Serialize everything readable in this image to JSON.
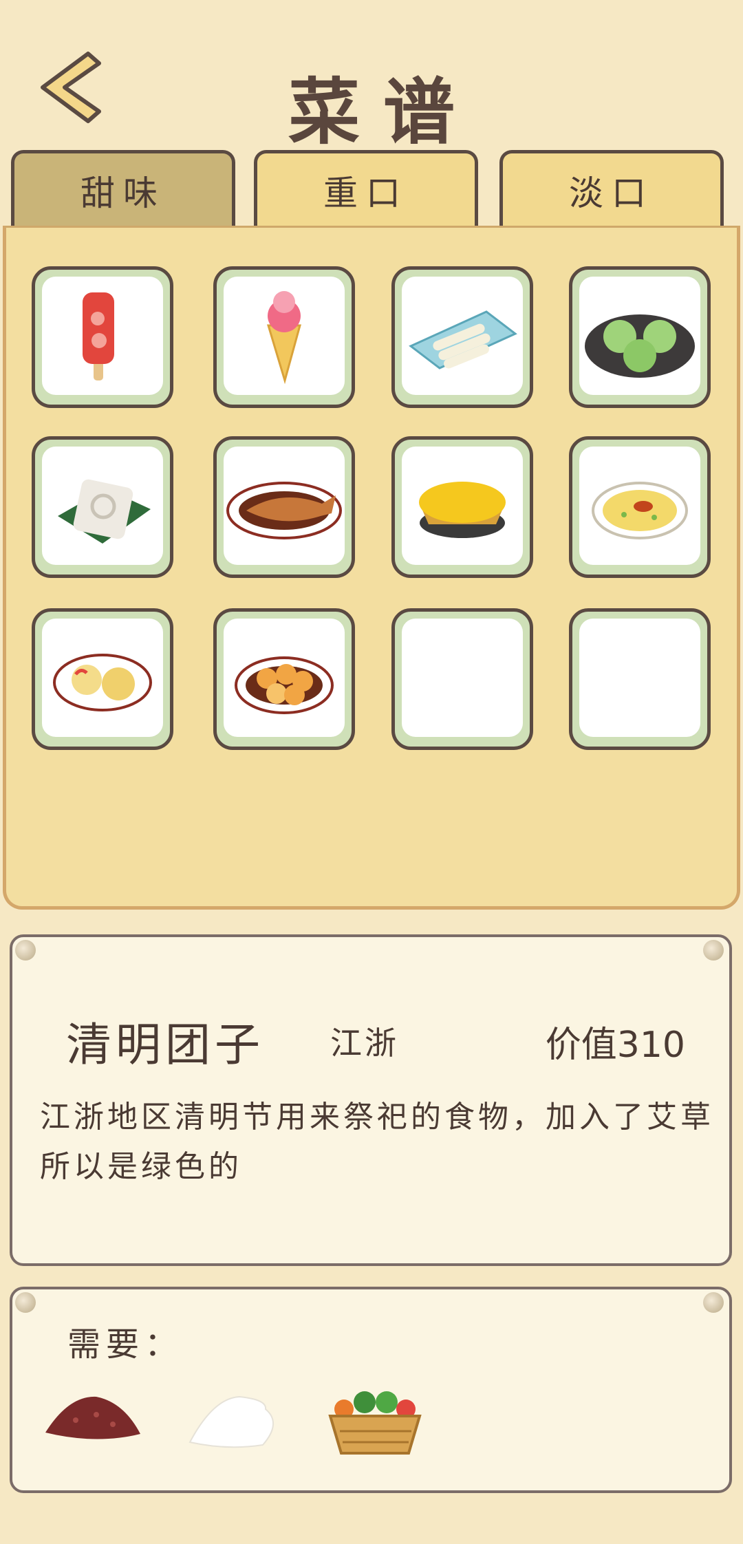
{
  "header": {
    "title": "菜谱"
  },
  "tabs": [
    {
      "label": "甜味",
      "active": true
    },
    {
      "label": "重口",
      "active": false
    },
    {
      "label": "淡口",
      "active": false
    }
  ],
  "grid": {
    "items": [
      {
        "icon": "popsicle-icon"
      },
      {
        "icon": "ice-cream-cone-icon"
      },
      {
        "icon": "rice-roll-icon"
      },
      {
        "icon": "green-dumplings-icon"
      },
      {
        "icon": "white-cake-icon"
      },
      {
        "icon": "braised-fish-icon"
      },
      {
        "icon": "egg-tart-icon"
      },
      {
        "icon": "scrambled-egg-icon"
      },
      {
        "icon": "pastry-plate-icon"
      },
      {
        "icon": "fried-balls-icon"
      },
      {
        "icon": ""
      },
      {
        "icon": ""
      }
    ]
  },
  "detail": {
    "name": "清明团子",
    "region": "江浙",
    "value": "价值310",
    "description": "江浙地区清明节用来祭祀的食物，加入了艾草所以是绿色的"
  },
  "requirements": {
    "label": "需要：",
    "ingredients": [
      {
        "icon": "red-bean-paste-icon"
      },
      {
        "icon": "flour-icon"
      },
      {
        "icon": "vegetable-basket-icon"
      }
    ]
  },
  "colors": {
    "background": "#f6e8c4",
    "panel": "#f3dea0",
    "tab": "#f2d98f",
    "tab_active": "#c9b478",
    "cell_border": "#cfe0b8",
    "text": "#4a3a33"
  }
}
